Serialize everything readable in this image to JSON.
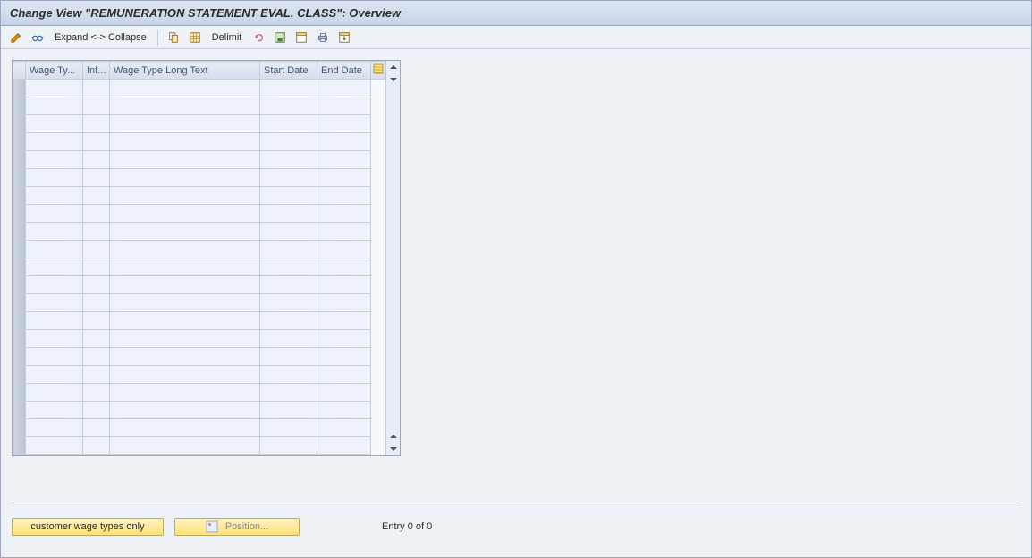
{
  "header": {
    "title": "Change View \"REMUNERATION STATEMENT EVAL. CLASS\": Overview"
  },
  "toolbar": {
    "expand_collapse_label": "Expand <-> Collapse",
    "delimit_label": "Delimit"
  },
  "table": {
    "columns": [
      {
        "label": "Wage Ty...",
        "width": 64
      },
      {
        "label": "Inf...",
        "width": 30
      },
      {
        "label": "Wage Type Long Text",
        "width": 168
      },
      {
        "label": "Start Date",
        "width": 64
      },
      {
        "label": "End Date",
        "width": 60
      }
    ],
    "row_count": 21
  },
  "footer": {
    "customer_wage_types_label": "customer wage types only",
    "position_label": "Position...",
    "entry_text": "Entry 0 of 0"
  }
}
